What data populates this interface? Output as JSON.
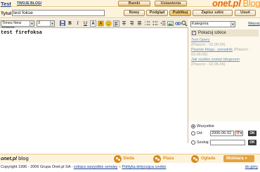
{
  "header": {
    "user_name": "Test",
    "my_blogs_link": "TWOJE BLOGI",
    "nav": [
      "Bamki",
      "Ustawienia"
    ],
    "brand": "onet.pl",
    "brand_suffix": "Blog"
  },
  "post": {
    "title_label": "Tytuł",
    "title_value": "test fokse",
    "body_text": "test firefoksa"
  },
  "actions": {
    "new": "Nowy",
    "preview": "Podgląd",
    "publish": "Publikuj",
    "save_draft": "Zapisz szkic",
    "delete": "Usuń"
  },
  "toolbar": {
    "font_family": "Times New Roman",
    "font_size": "3",
    "arrow": "▼"
  },
  "sidebar": {
    "category": "Kategoria",
    "more_link": "Więcej",
    "show_drafts_label": "Pokazuj szkice",
    "drafts": [
      {
        "title": "Test Opery",
        "meta": "(Ptaszor - 02.06.06)"
      },
      {
        "title": "Pisanie bloga - poradnik",
        "meta": "(Ptaszor - 02.06.06)"
      },
      {
        "title": "Jak szybko zostać blogerem",
        "meta": "(Ptaszor - 02.06.06)"
      }
    ]
  },
  "filter": {
    "all_label": "Wszystkie",
    "from_label": "Od:",
    "date_value": "2006-06-02",
    "search_label": "Szukaj:",
    "ok_label": "OK",
    "cal_label": "📅▾"
  },
  "footer": {
    "brand": "onet.pl",
    "brand_suffix": "blog",
    "sections": [
      "Sieda",
      "Plaza",
      "Oglada"
    ],
    "mobile": "Mobiiara »",
    "copyright": "Copyright 1996 - 2006 Grupa Onet.pl SA -",
    "all_services": "zobacz wszystkie serwisy",
    "separator": "»",
    "cookie_policy": "Polityka dotycząca cookie",
    "to_top": "do góry"
  },
  "colors": {
    "accent": "#e86b0c",
    "link": "#1a3f87",
    "header_bg": "#fdf3dc"
  }
}
